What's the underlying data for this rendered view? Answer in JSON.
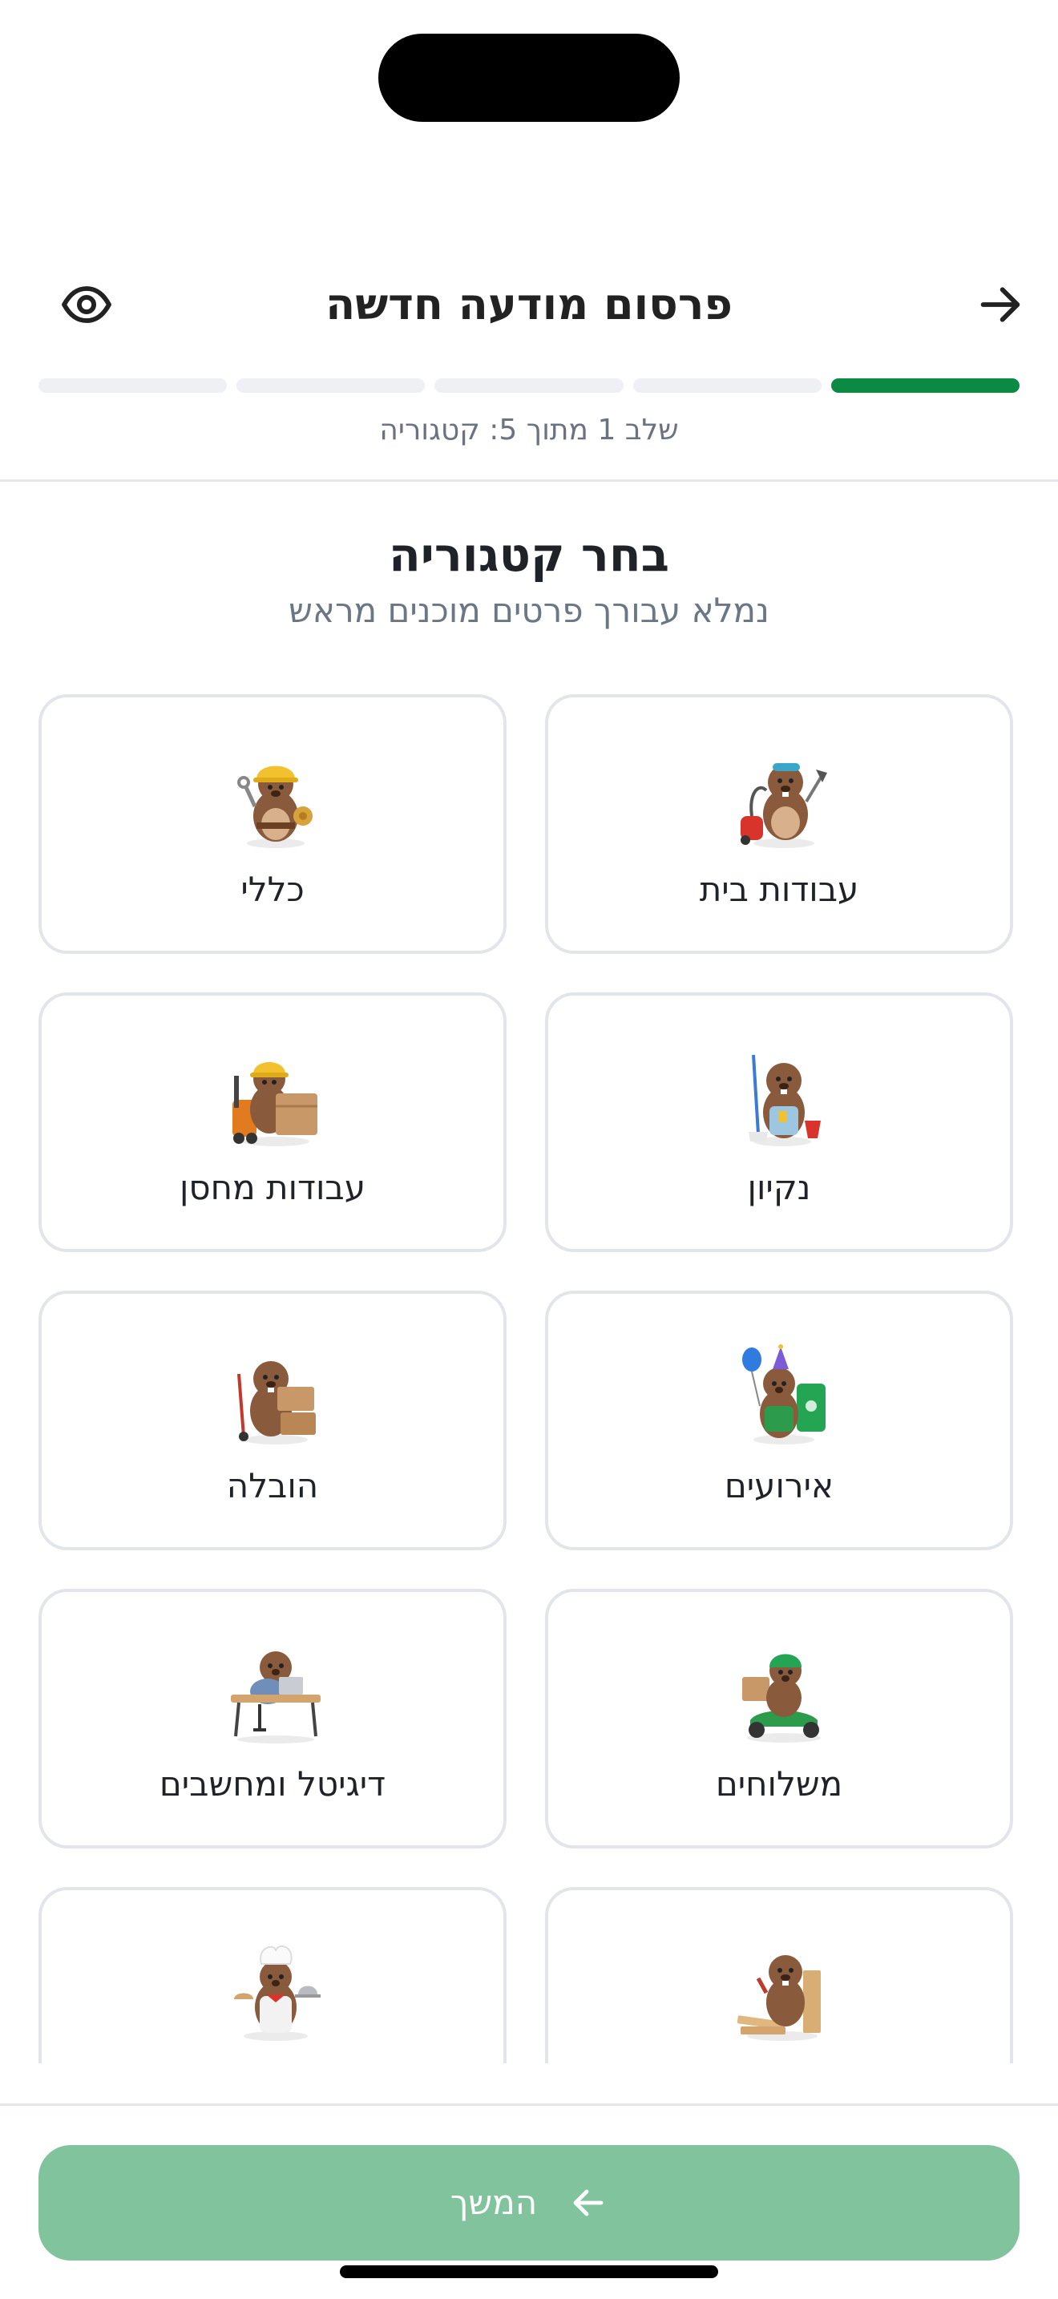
{
  "header": {
    "title": "פרסום מודעה חדשה"
  },
  "progress": {
    "total_steps": 5,
    "current_step": 1,
    "step_text": "שלב 1 מתוך 5: קטגוריה"
  },
  "section": {
    "title": "בחר קטגוריה",
    "subtitle": "נמלא עבורך פרטים מוכנים מראש"
  },
  "categories": [
    {
      "label": "עבודות בית",
      "icon": "beaver-vacuum-icon"
    },
    {
      "label": "כללי",
      "icon": "beaver-helmet-wrench-icon"
    },
    {
      "label": "נקיון",
      "icon": "beaver-mop-icon"
    },
    {
      "label": "עבודות מחסן",
      "icon": "beaver-forklift-icon"
    },
    {
      "label": "אירועים",
      "icon": "beaver-party-icon"
    },
    {
      "label": "הובלה",
      "icon": "beaver-boxes-icon"
    },
    {
      "label": "משלוחים",
      "icon": "beaver-scooter-icon"
    },
    {
      "label": "דיגיטל ומחשבים",
      "icon": "beaver-laptop-icon"
    },
    {
      "label": "",
      "icon": "beaver-carpentry-icon"
    },
    {
      "label": "",
      "icon": "beaver-chef-icon"
    }
  ],
  "cta": {
    "label": "המשך"
  },
  "colors": {
    "accent": "#0b8a43",
    "cta_disabled": "#80c39c",
    "beaver": "#8a5a3c"
  }
}
